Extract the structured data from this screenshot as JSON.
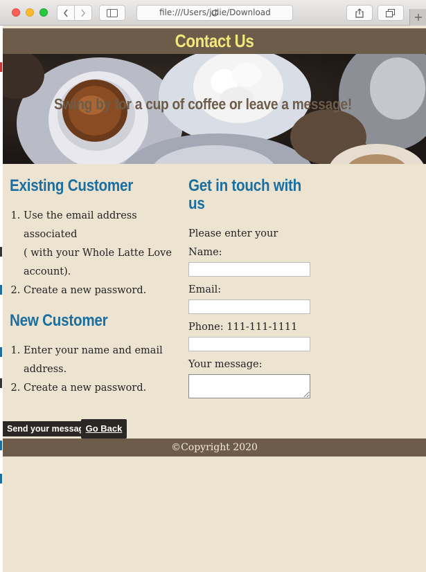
{
  "browser": {
    "address": "file:///Users/julie/Downloads",
    "colors": {
      "close": "#fc5f57",
      "minimize": "#fdbc2e",
      "maximize": "#28c840"
    }
  },
  "header": {
    "title": "Contact Us"
  },
  "hero": {
    "tagline": "Swing by for a cup of coffee or leave a message!"
  },
  "existing": {
    "heading": "Existing Customer",
    "steps": [
      {
        "line1": "Use the email address",
        "line2": "associated",
        "line3": "( with your Whole Latte Love",
        "line4": "account)."
      },
      {
        "line1": "Create a new password."
      }
    ]
  },
  "new_customer": {
    "heading": "New Customer",
    "steps": [
      {
        "line1": "Enter your name and email",
        "line2": "address."
      },
      {
        "line1": "Create a new password."
      }
    ]
  },
  "contact": {
    "heading": "Get in touch with us",
    "intro": "Please enter your",
    "name_label": "Name:",
    "email_label": "Email:",
    "phone_label": "Phone: 111-111-1111",
    "message_label": "Your message:"
  },
  "buttons": {
    "send": "Send your message",
    "back": "Go Back"
  },
  "footer": {
    "copyright": "©Copyright 2020"
  },
  "colors": {
    "brown": "#6d5c49",
    "title_yellow": "#f2e77c",
    "heading_blue": "#1a6fa0",
    "page_bg": "#ede3d1"
  }
}
